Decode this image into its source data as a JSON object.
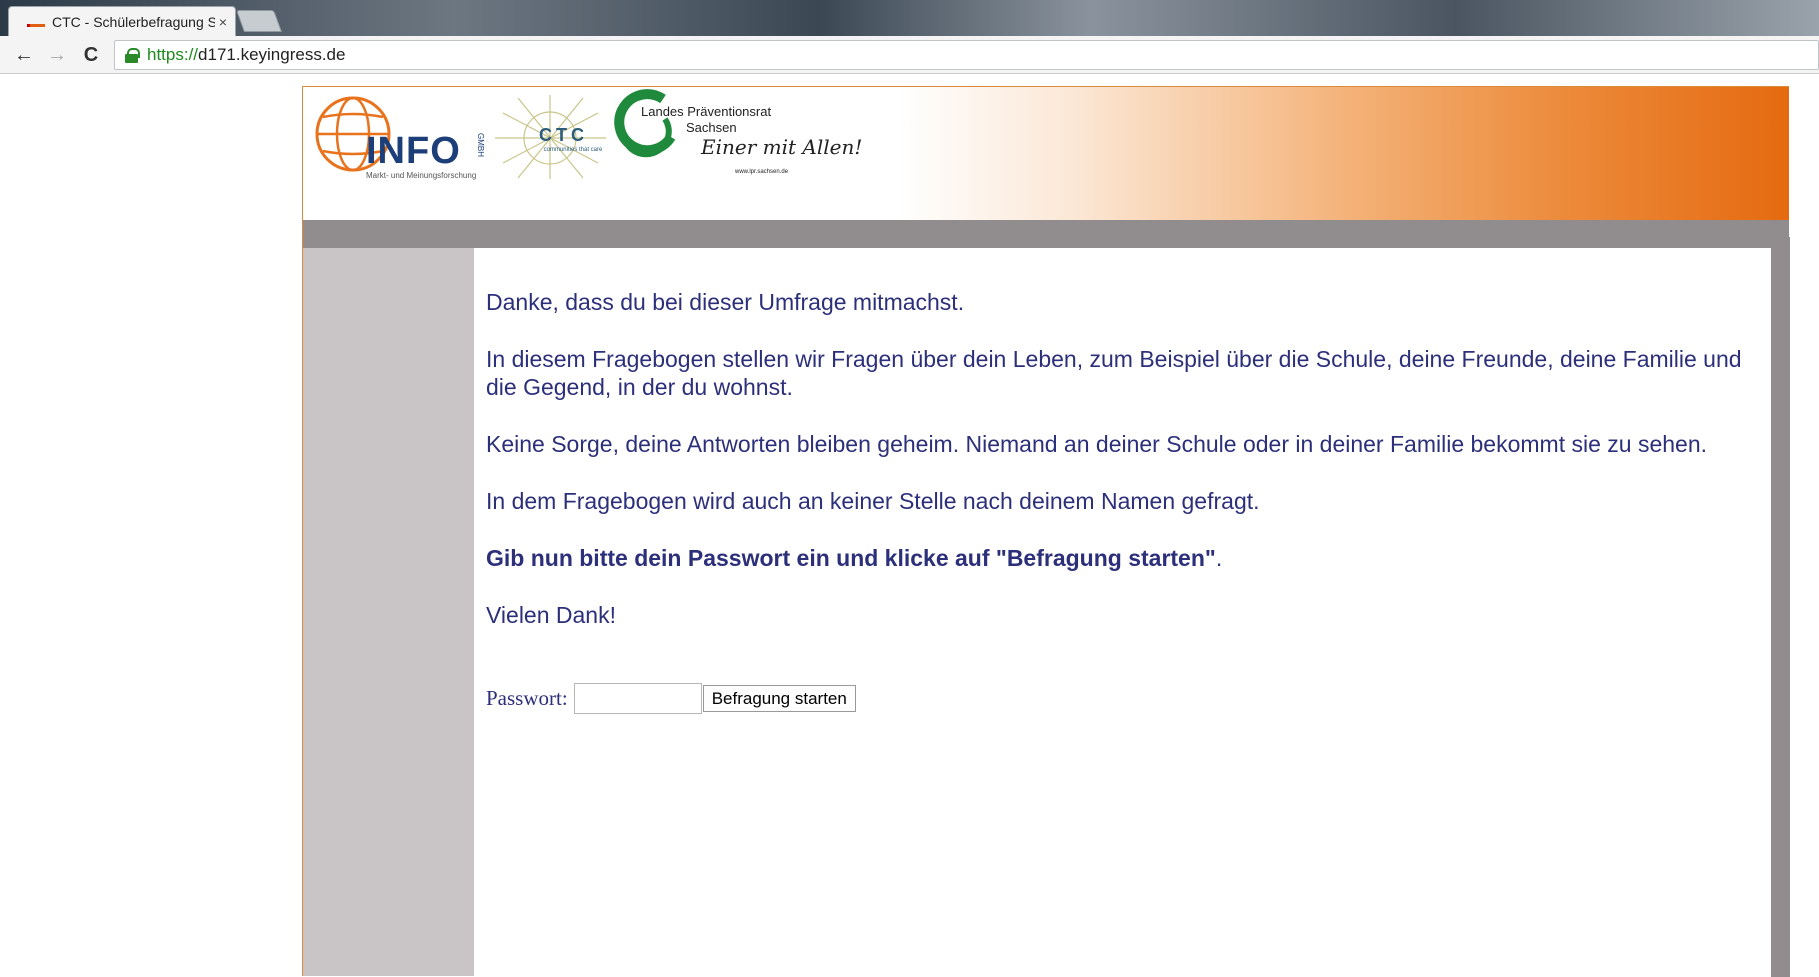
{
  "browser": {
    "tab_title": "CTC - Schülerbefragung S",
    "tab_close": "×",
    "url_scheme": "https://",
    "url_host": "d171.keyingress.de",
    "back_icon": "←",
    "forward_icon": "→",
    "reload_icon": "C"
  },
  "header": {
    "info_logo_text": "INFO",
    "info_logo_gmbh": "GMBH",
    "info_logo_subtitle": "Markt- und Meinungsforschung",
    "ctc_logo_text": "CTC",
    "ctc_logo_subtitle": "communities that care",
    "lpr_logo_title": "Landes Präventionsrat",
    "lpr_logo_region": "Sachsen",
    "lpr_logo_slogan": "Einer mit Allen!",
    "lpr_logo_url": "www.lpr.sachsen.de"
  },
  "main": {
    "paragraphs": [
      "Danke, dass du bei dieser Umfrage mitmachst.",
      "In diesem Fragebogen stellen wir Fragen über dein Leben, zum Beispiel über die Schule, deine Freunde, deine Familie und die Gegend, in der du wohnst.",
      "Keine Sorge, deine Antworten bleiben geheim. Niemand an deiner Schule oder in deiner Familie bekommt sie zu sehen.",
      "In dem Fragebogen wird auch an keiner Stelle nach deinem Namen gefragt."
    ],
    "instruction_bold": "Gib nun bitte dein Passwort ein und klicke auf \"Befragung starten\"",
    "instruction_end": ".",
    "thanks": "Vielen Dank!"
  },
  "form": {
    "password_label": "Passwort:",
    "password_value": "",
    "submit_label": "Befragung starten"
  },
  "colors": {
    "text": "#2c2f7a",
    "banner_orange": "#e56a10",
    "sidebar_grey": "#c9c5c6",
    "bar_grey": "#918c8d"
  }
}
